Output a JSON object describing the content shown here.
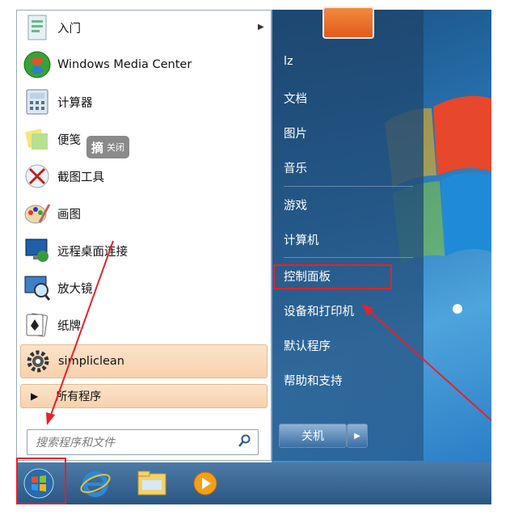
{
  "start_menu": {
    "programs": [
      {
        "label": "入门",
        "icon": "getting-started-icon",
        "has_submenu": true
      },
      {
        "label": "Windows Media Center",
        "icon": "media-center-icon"
      },
      {
        "label": "计算器",
        "icon": "calculator-icon"
      },
      {
        "label": "便笺",
        "icon": "sticky-notes-icon"
      },
      {
        "label": "截图工具",
        "icon": "snipping-tool-icon"
      },
      {
        "label": "画图",
        "icon": "paint-icon"
      },
      {
        "label": "远程桌面连接",
        "icon": "remote-desktop-icon"
      },
      {
        "label": "放大镜",
        "icon": "magnifier-icon"
      },
      {
        "label": "纸牌",
        "icon": "solitaire-icon"
      },
      {
        "label": "simpliclean",
        "icon": "gear-icon",
        "highlighted": true
      }
    ],
    "all_programs": "所有程序",
    "search_placeholder": "搜索程序和文件",
    "tooltip": {
      "big": "摘",
      "small": "关闭"
    },
    "right_items": [
      "lz",
      "文档",
      "图片",
      "音乐",
      "游戏",
      "计算机",
      "控制面板",
      "设备和打印机",
      "默认程序",
      "帮助和支持"
    ],
    "shutdown_label": "关机"
  },
  "taskbar": {
    "buttons": [
      "start-orb-icon",
      "internet-explorer-icon",
      "folder-icon",
      "media-player-icon"
    ]
  },
  "colors": {
    "annotation_red": "#e8202a",
    "highlight": "#f8d1ab"
  }
}
